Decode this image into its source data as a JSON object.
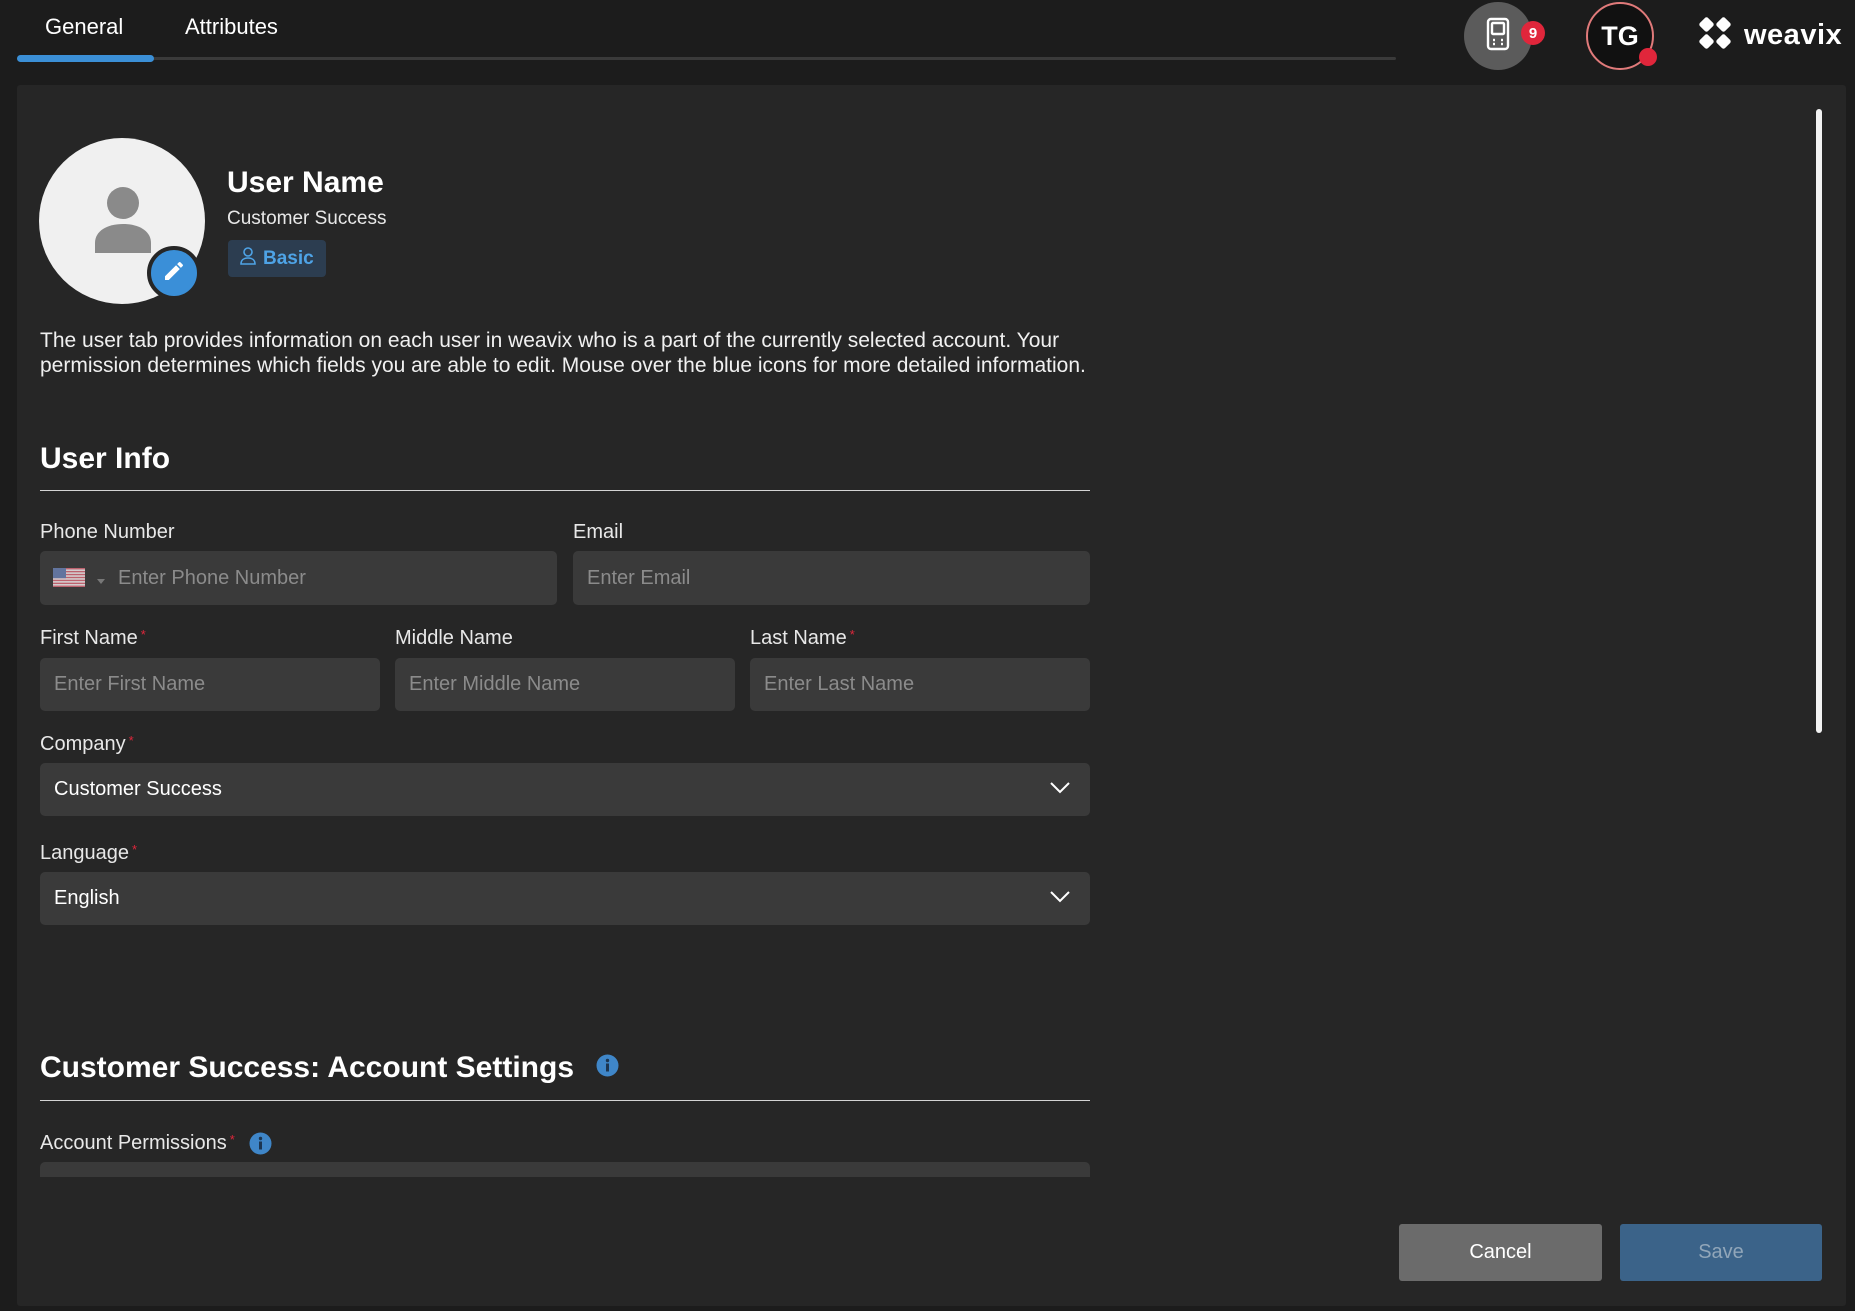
{
  "tabs": [
    {
      "label": "General",
      "active": true
    },
    {
      "label": "Attributes",
      "active": false
    }
  ],
  "header": {
    "device_badge_count": "9",
    "user_initials": "TG",
    "brand_name": "weavix"
  },
  "profile": {
    "name": "User Name",
    "subtitle": "Customer Success",
    "role_badge": "Basic"
  },
  "description": "The user tab provides information on each user in weavix who is a part of the currently selected account. Your permission determines which fields you are able to edit. Mouse over the blue icons for more detailed information.",
  "required_mark": "*",
  "user_info": {
    "heading": "User Info",
    "phone_number": {
      "label": "Phone Number",
      "placeholder": "Enter Phone Number",
      "value": "",
      "required": false,
      "country_flag_icon": "us-flag-icon"
    },
    "email": {
      "label": "Email",
      "placeholder": "Enter Email",
      "value": "",
      "required": false
    },
    "first_name": {
      "label": "First Name",
      "placeholder": "Enter First Name",
      "value": "",
      "required": true
    },
    "middle_name": {
      "label": "Middle Name",
      "placeholder": "Enter Middle Name",
      "value": "",
      "required": false
    },
    "last_name": {
      "label": "Last Name",
      "placeholder": "Enter Last Name",
      "value": "",
      "required": true
    },
    "company": {
      "label": "Company",
      "value": "Customer Success",
      "required": true
    },
    "language": {
      "label": "Language",
      "value": "English",
      "required": true
    }
  },
  "account_settings": {
    "heading": "Customer Success: Account Settings",
    "permissions": {
      "label": "Account Permissions",
      "value": "",
      "required": true
    }
  },
  "actions": {
    "cancel_label": "Cancel",
    "save_label": "Save"
  },
  "icons": {
    "device": "device-icon",
    "edit": "pencil-icon",
    "role": "user-icon",
    "info": "info-icon",
    "dropdown": "chevron-down-icon",
    "brand": "weavix-logo-icon"
  },
  "colors": {
    "accent": "#3b8fd6",
    "alert": "#e0263b",
    "role_badge_text": "#4ea3e6",
    "save_button": "#3b6389",
    "cancel_button": "#6b6b6b"
  }
}
